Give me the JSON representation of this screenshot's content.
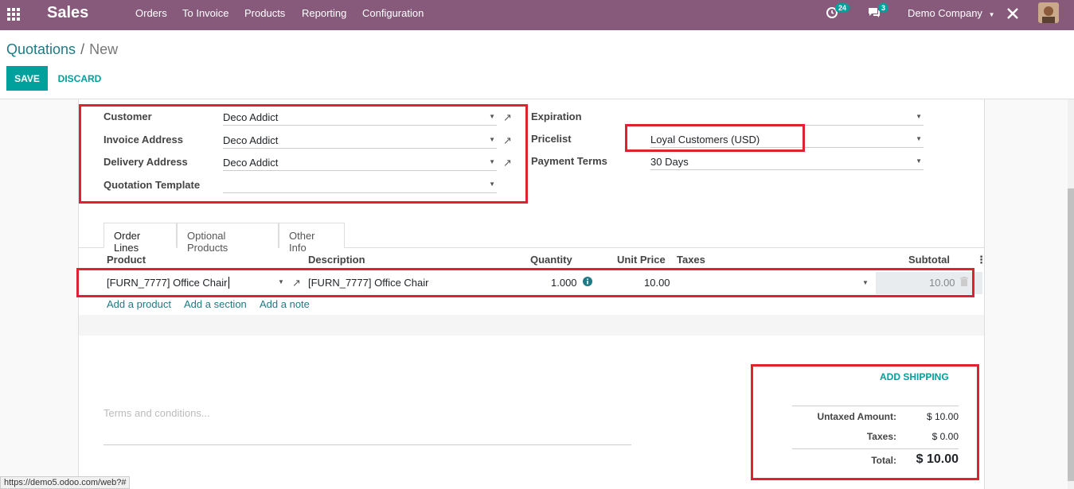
{
  "navbar": {
    "app_name": "Sales",
    "menu": [
      "Orders",
      "To Invoice",
      "Products",
      "Reporting",
      "Configuration"
    ],
    "activity_count": "24",
    "messages_count": "3",
    "company": "Demo Company",
    "icons": [
      "apps-grid-icon",
      "clock-icon",
      "chat-icon",
      "tools-icon",
      "user-avatar"
    ]
  },
  "breadcrumb": {
    "parent": "Quotations",
    "separator": "/",
    "current": "New"
  },
  "buttons": {
    "save": "SAVE",
    "discard": "DISCARD"
  },
  "form": {
    "customer_label": "Customer",
    "customer_value": "Deco Addict",
    "invoice_label": "Invoice Address",
    "invoice_value": "Deco Addict",
    "delivery_label": "Delivery Address",
    "delivery_value": "Deco Addict",
    "template_label": "Quotation Template",
    "template_value": "",
    "expiration_label": "Expiration",
    "expiration_value": "",
    "pricelist_label": "Pricelist",
    "pricelist_value": "Loyal Customers (USD)",
    "terms_label": "Payment Terms",
    "terms_value": "30 Days"
  },
  "tabs": [
    "Order Lines",
    "Optional Products",
    "Other Info"
  ],
  "table": {
    "headers": {
      "product": "Product",
      "description": "Description",
      "quantity": "Quantity",
      "unit_price": "Unit Price",
      "taxes": "Taxes",
      "subtotal": "Subtotal"
    },
    "row": {
      "product": "[FURN_7777] Office Chair",
      "description": "[FURN_7777] Office Chair",
      "quantity": "1.000",
      "unit_price": "10.00",
      "taxes": "",
      "subtotal": "10.00"
    },
    "add_links": [
      "Add a product",
      "Add a section",
      "Add a note"
    ]
  },
  "terms_placeholder": "Terms and conditions...",
  "totals": {
    "add_shipping": "ADD SHIPPING",
    "untaxed_label": "Untaxed Amount:",
    "untaxed_value": "$ 10.00",
    "taxes_label": "Taxes:",
    "taxes_value": "$ 0.00",
    "total_label": "Total:",
    "total_value": "$ 10.00"
  },
  "status_url": "https://demo5.odoo.com/web?#",
  "colors": {
    "navbar": "#875a7b",
    "accent": "#00a09d",
    "highlight_box": "#e0212f"
  }
}
